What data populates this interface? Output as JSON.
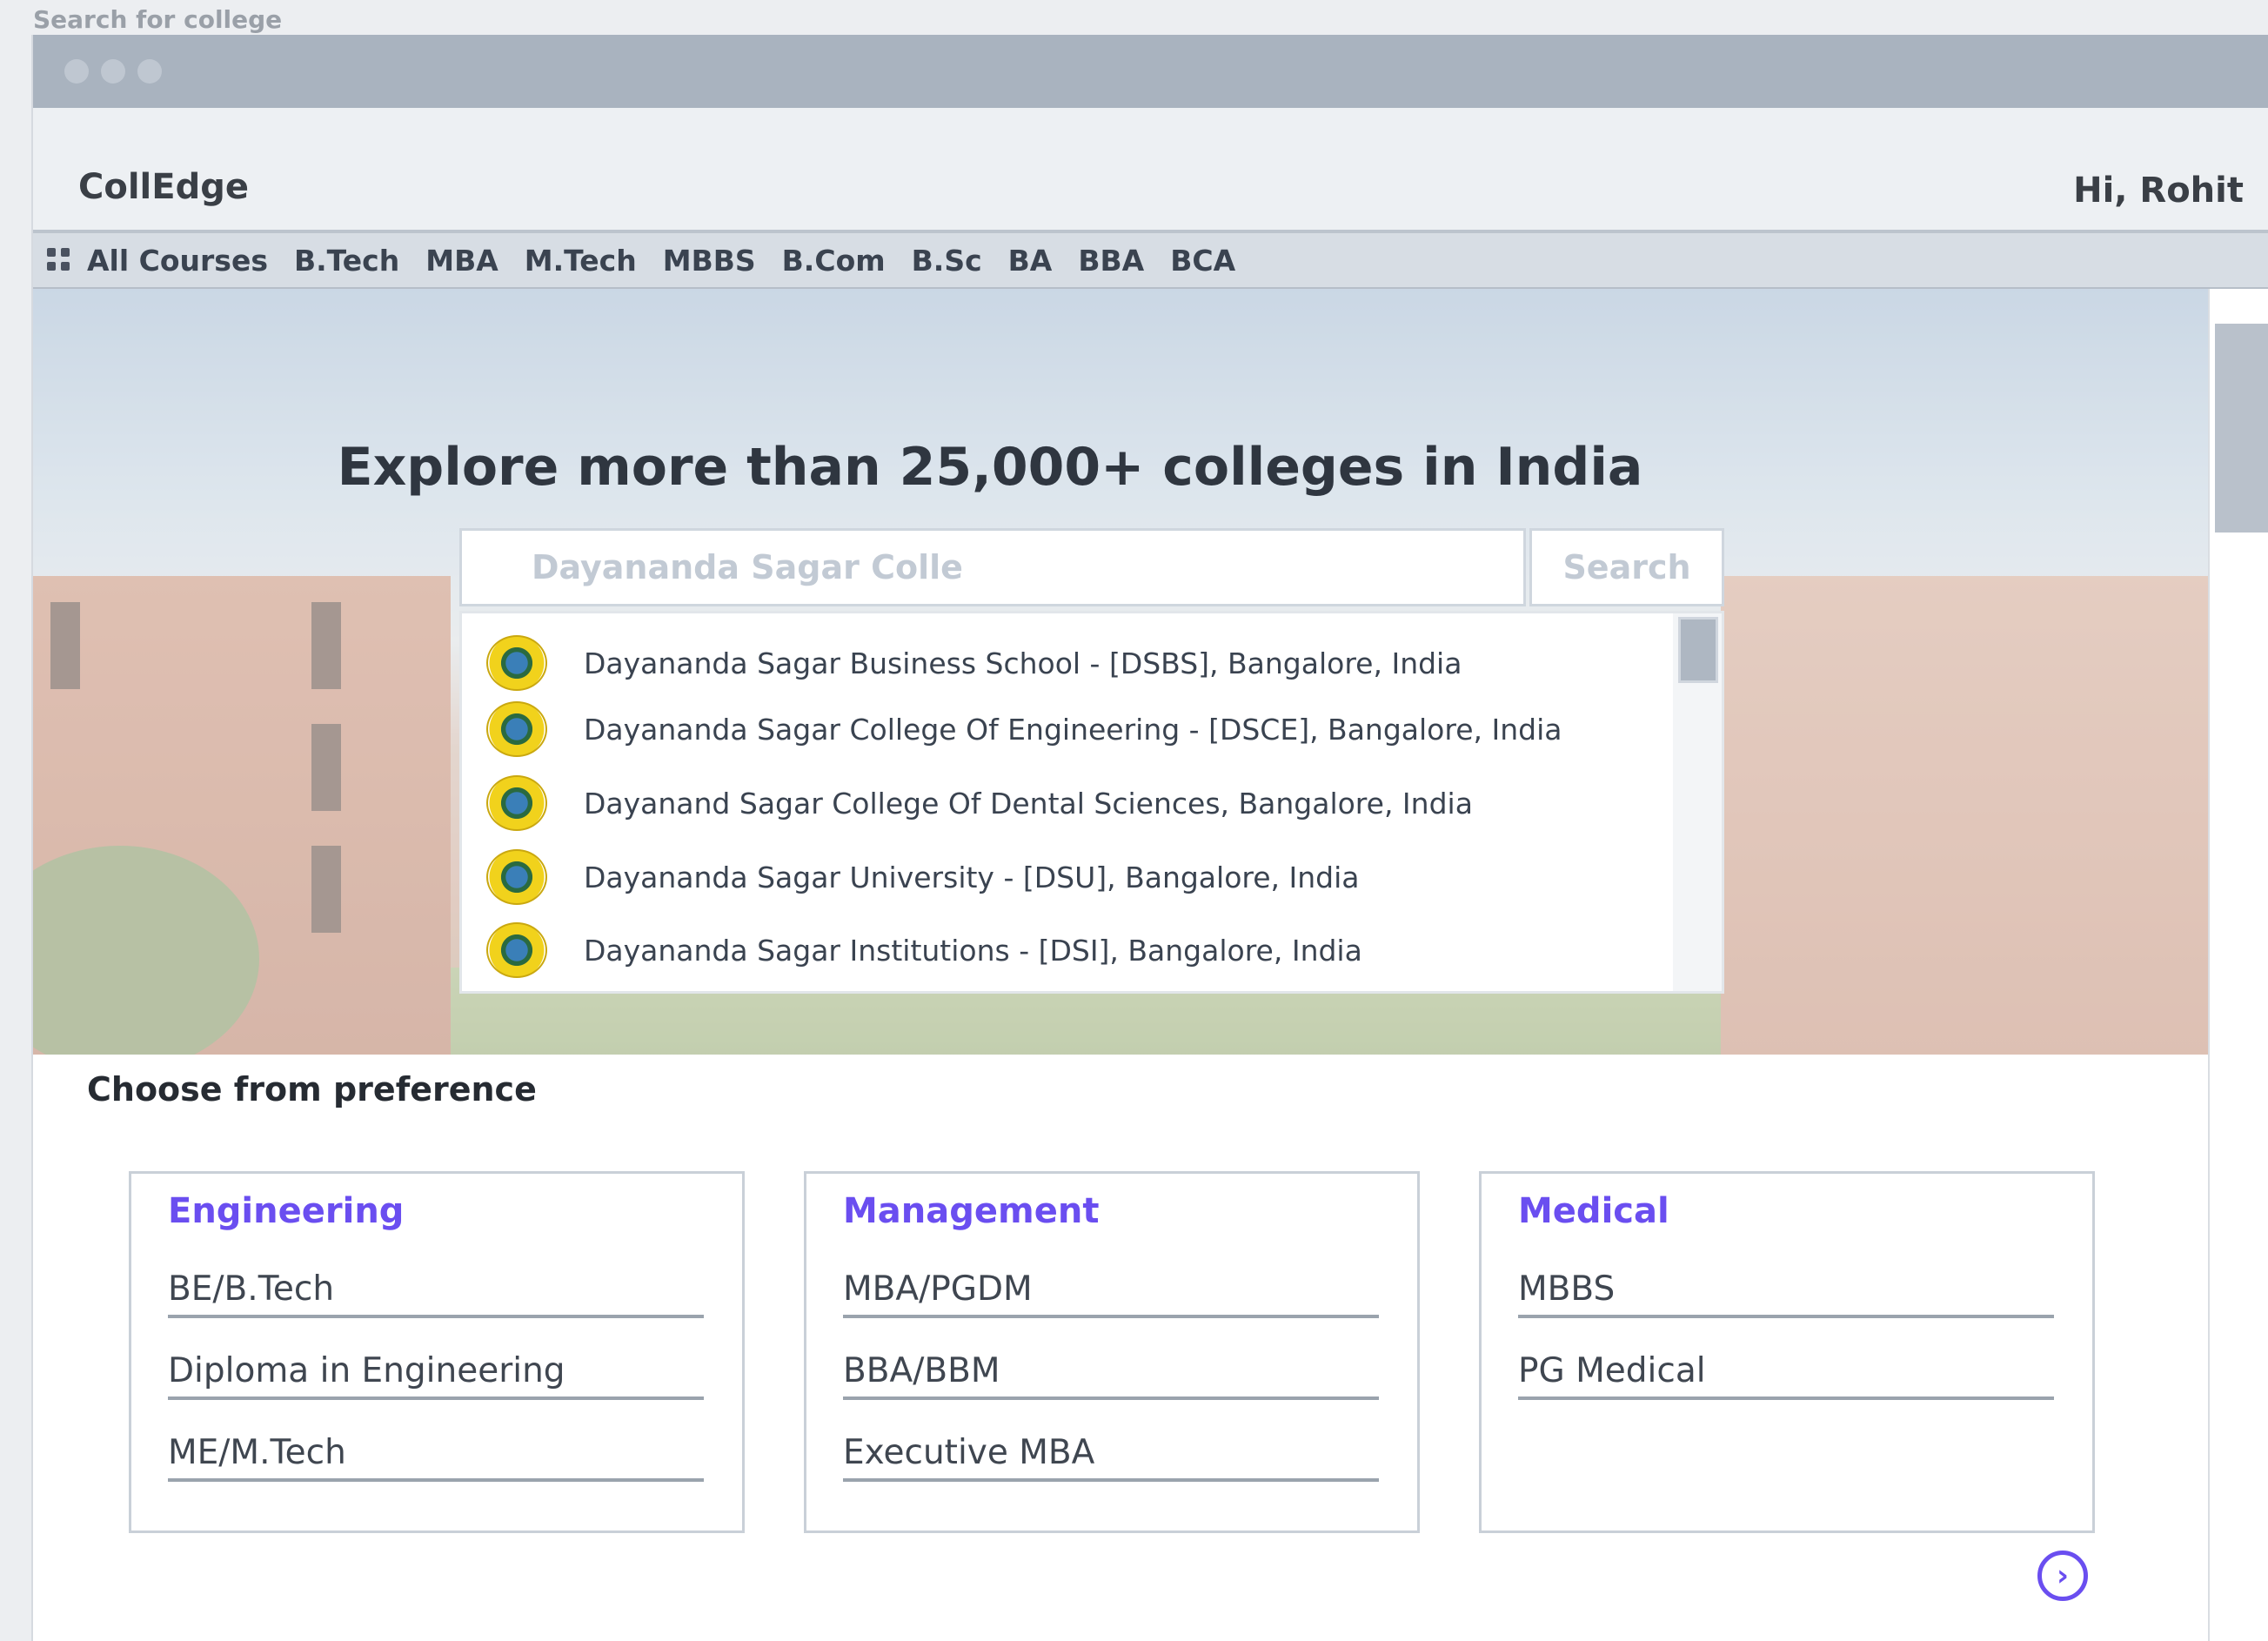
{
  "caption": "Search for college",
  "window": {
    "title_controls": [
      "close",
      "minimize",
      "maximize"
    ]
  },
  "header": {
    "brand": "CollEdge",
    "greeting": "Hi, Rohit"
  },
  "nav": {
    "icon": "grid-icon",
    "items": [
      "All Courses",
      "B.Tech",
      "MBA",
      "M.Tech",
      "MBBS",
      "B.Com",
      "B.Sc",
      "BA",
      "BBA",
      "BCA"
    ]
  },
  "hero": {
    "headline": "Explore more than 25,000+ colleges in India",
    "search": {
      "value": "Dayananda Sagar Colle",
      "button_label": "Search"
    },
    "suggestions": [
      "Dayananda Sagar Business School - [DSBS], Bangalore, India",
      "Dayananda Sagar College Of Engineering - [DSCE], Bangalore, India",
      "Dayanand Sagar College Of Dental Sciences, Bangalore, India",
      "Dayananda Sagar University - [DSU], Bangalore, India",
      "Dayananda Sagar Institutions - [DSI], Bangalore, India"
    ]
  },
  "preference": {
    "title": "Choose from preference",
    "categories": [
      {
        "title": "Engineering",
        "items": [
          "BE/B.Tech",
          "Diploma in Engineering",
          "ME/M.Tech"
        ]
      },
      {
        "title": "Management",
        "items": [
          "MBA/PGDM",
          "BBA/BBM",
          "Executive MBA"
        ]
      },
      {
        "title": "Medical",
        "items": [
          "MBBS",
          "PG Medical"
        ]
      }
    ],
    "next_icon": "chevron-right-circle-icon"
  },
  "colors": {
    "accent": "#6a4ef0",
    "titlebar": "#a9b3bf",
    "navbar": "#d7dde4"
  }
}
